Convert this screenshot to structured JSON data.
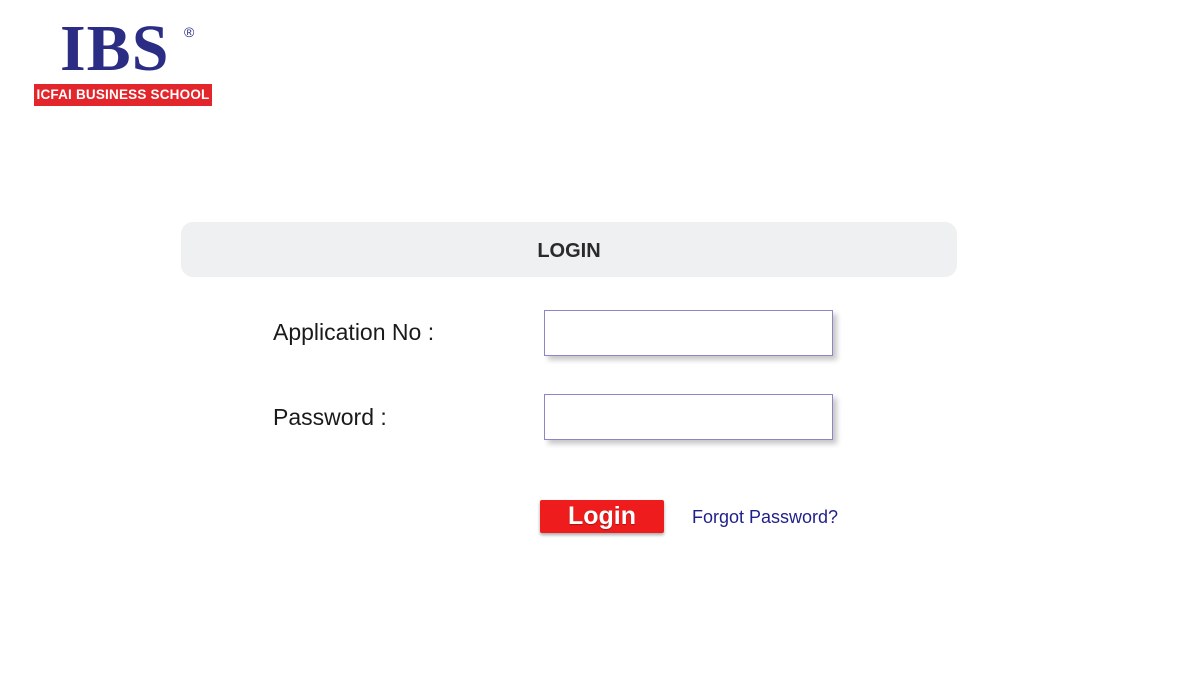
{
  "logo": {
    "letters": "IBS",
    "registered_mark": "®",
    "tagline": "ICFAI BUSINESS SCHOOL",
    "colors": {
      "letters": "#2b2c83",
      "band": "#e3262b"
    }
  },
  "login_panel": {
    "title": "LOGIN"
  },
  "form": {
    "application_no": {
      "label": "Application No :",
      "value": "",
      "placeholder": ""
    },
    "password": {
      "label": "Password :",
      "value": "",
      "placeholder": ""
    },
    "submit_label": "Login",
    "forgot_password_label": "Forgot Password?"
  },
  "colors": {
    "button": "#ee1c1c",
    "link": "#1f1f8a",
    "panel_bg": "#eef0f2"
  }
}
